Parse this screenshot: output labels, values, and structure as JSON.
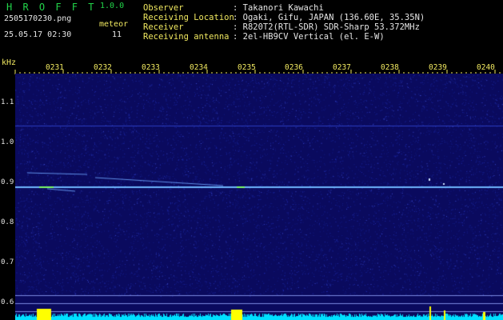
{
  "header": {
    "app_name": "H R O F F T",
    "app_version": "1.0.0",
    "file_name": "2505170230.png",
    "datetime": "25.05.17 02:30",
    "meteor_label": "meteor",
    "meteor_count": "11"
  },
  "info": [
    {
      "label": "Observer",
      "value": ": Takanori Kawachi"
    },
    {
      "label": "Receiving Location",
      "value": ": Ogaki, Gifu, JAPAN (136.60E, 35.35N)"
    },
    {
      "label": "Receiver",
      "value": ": R820T2(RTL-SDR) SDR-Sharp 53.372MHz"
    },
    {
      "label": "Receiving antenna",
      "value": ": 2el-HB9CV Vertical (el. E-W)"
    }
  ],
  "plot": {
    "unit": "kHz",
    "time_ticks": [
      "0231",
      "0232",
      "0233",
      "0234",
      "0235",
      "0236",
      "0237",
      "0238",
      "0239",
      "0240"
    ],
    "freq_ticks": [
      "1.1",
      "1.0",
      "0.9",
      "0.8",
      "0.7",
      "0.6"
    ],
    "colors": {
      "background": "#0a0a5e",
      "signal": "#6fb6ff",
      "strong": "#7dff6a",
      "baseline": "#00e0ff",
      "peak": "#ffff00",
      "axis": "#f0e860"
    }
  }
}
